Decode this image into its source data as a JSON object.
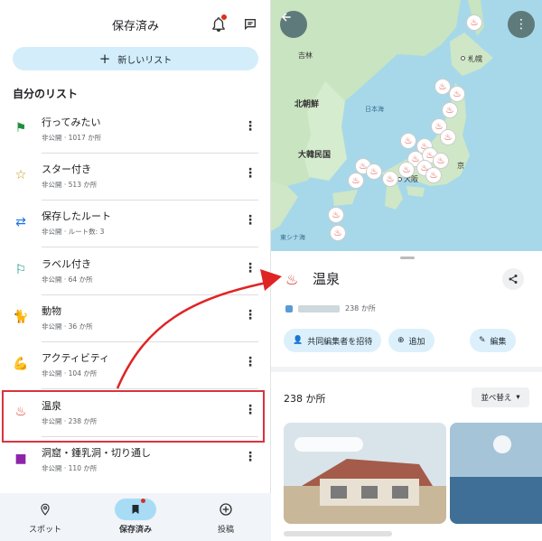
{
  "left": {
    "header_title": "保存済み",
    "new_list_label": "新しいリスト",
    "section_title": "自分のリスト",
    "lists": [
      {
        "name": "行ってみたい",
        "meta": "非公開 · 1017 か所",
        "icon": "flag-icon",
        "icon_color": "#1e8e3e"
      },
      {
        "name": "スター付き",
        "meta": "非公開 · 513 か所",
        "icon": "star-icon",
        "icon_color": "#c69214"
      },
      {
        "name": "保存したルート",
        "meta": "非公開 · ルート数: 3",
        "icon": "route-icon",
        "icon_color": "#1a73e8"
      },
      {
        "name": "ラベル付き",
        "meta": "非公開 · 64 か所",
        "icon": "label-icon",
        "icon_color": "#00897b"
      },
      {
        "name": "動物",
        "meta": "非公開 · 36 か所",
        "icon": "animal-icon",
        "icon_color": "#e0a100"
      },
      {
        "name": "アクティビティ",
        "meta": "非公開 · 104 か所",
        "icon": "activity-icon",
        "icon_color": "#e0a100"
      },
      {
        "name": "温泉",
        "meta": "非公開 · 238 か所",
        "icon": "hot-spring-icon",
        "icon_color": "#d93025"
      },
      {
        "name": "洞窟・鍾乳洞・切り通し",
        "meta": "非公開 · 110 か所",
        "icon": "cave-icon",
        "icon_color": "#8e24aa"
      }
    ],
    "nav": {
      "spot": "スポット",
      "saved": "保存済み",
      "post": "投稿"
    }
  },
  "map": {
    "labels": {
      "jilin": "吉林",
      "north_korea": "北朝鮮",
      "south_korea": "大韓民国",
      "sea_of_japan": "日本海",
      "sapporo": "札幌",
      "osaka": "大阪",
      "tokyo": "京",
      "east_china_sea": "東シナ海"
    }
  },
  "right": {
    "title": "温泉",
    "meta": "238 か所",
    "chips": {
      "invite": "共同編集者を招待",
      "add": "追加",
      "edit": "編集"
    },
    "count": "238 か所",
    "sort": "並べ替え"
  },
  "colors": {
    "accent": "#d93025",
    "chip_bg": "#dcf0fb",
    "highlight": "#d9333d"
  }
}
